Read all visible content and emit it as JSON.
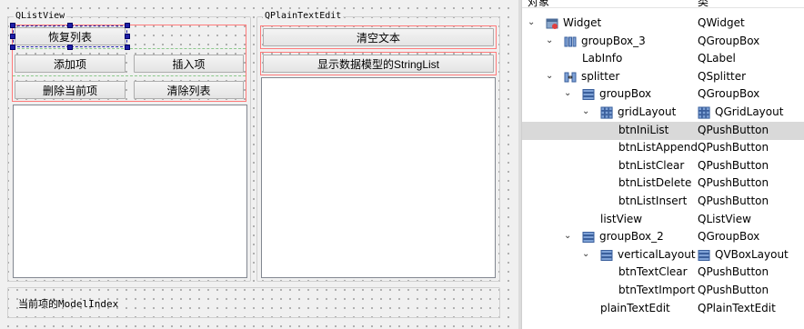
{
  "form": {
    "group_left_title": "QListView",
    "group_right_title": "QPlainTextEdit",
    "buttons": {
      "restore_list": "恢复列表",
      "add_item": "添加项",
      "insert_item": "插入项",
      "delete_current": "删除当前项",
      "clear_list": "清除列表",
      "clear_text": "清空文本",
      "show_stringlist": "显示数据模型的StringList"
    },
    "label_info": "当前项的ModelIndex"
  },
  "inspector": {
    "header_object": "对象",
    "header_class": "类",
    "rows": [
      {
        "name": "Widget",
        "cls": "QWidget",
        "icon": "widget-icon",
        "expanded": true
      },
      {
        "name": "groupBox_3",
        "cls": "QGroupBox",
        "icon": "hbox-layout-icon",
        "expanded": true
      },
      {
        "name": "LabInfo",
        "cls": "QLabel",
        "icon": "",
        "expanded": null
      },
      {
        "name": "splitter",
        "cls": "QSplitter",
        "icon": "splitter-icon",
        "expanded": true
      },
      {
        "name": "groupBox",
        "cls": "QGroupBox",
        "icon": "vbox-layout-icon",
        "expanded": true
      },
      {
        "name": "gridLayout",
        "cls": "QGridLayout",
        "icon": "grid-layout-icon",
        "expanded": true
      },
      {
        "name": "btnIniList",
        "cls": "QPushButton",
        "icon": "",
        "expanded": null
      },
      {
        "name": "btnListAppend",
        "cls": "QPushButton",
        "icon": "",
        "expanded": null
      },
      {
        "name": "btnListClear",
        "cls": "QPushButton",
        "icon": "",
        "expanded": null
      },
      {
        "name": "btnListDelete",
        "cls": "QPushButton",
        "icon": "",
        "expanded": null
      },
      {
        "name": "btnListInsert",
        "cls": "QPushButton",
        "icon": "",
        "expanded": null
      },
      {
        "name": "listView",
        "cls": "QListView",
        "icon": "",
        "expanded": null
      },
      {
        "name": "groupBox_2",
        "cls": "QGroupBox",
        "icon": "vbox-layout-icon",
        "expanded": true
      },
      {
        "name": "verticalLayout",
        "cls": "QVBoxLayout",
        "icon": "vbox-layout-icon",
        "expanded": true
      },
      {
        "name": "btnTextClear",
        "cls": "QPushButton",
        "icon": "",
        "expanded": null
      },
      {
        "name": "btnTextImport",
        "cls": "QPushButton",
        "icon": "",
        "expanded": null
      },
      {
        "name": "plainTextEdit",
        "cls": "QPlainTextEdit",
        "icon": "",
        "expanded": null
      }
    ],
    "selected_row": "btnIniList"
  }
}
